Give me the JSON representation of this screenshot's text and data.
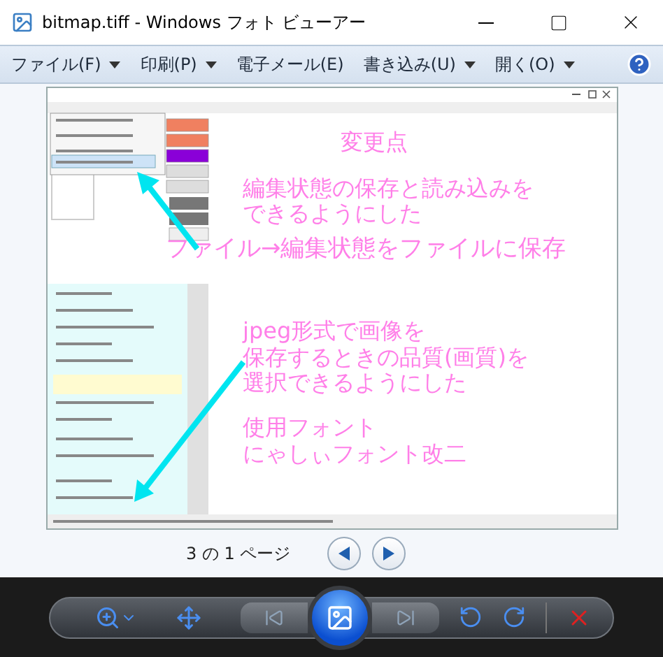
{
  "window": {
    "title": "bitmap.tiff - Windows フォト ビューアー"
  },
  "menu": [
    {
      "label": "ファイル(F)",
      "dropdown": true
    },
    {
      "label": "印刷(P)",
      "dropdown": true
    },
    {
      "label": "電子メール(E)",
      "dropdown": false
    },
    {
      "label": "書き込み(U)",
      "dropdown": true
    },
    {
      "label": "開く(O)",
      "dropdown": true
    }
  ],
  "image": {
    "notes": [
      {
        "kind": "title",
        "lines": [
          "変更点"
        ]
      },
      {
        "kind": "note",
        "lines": [
          "編集状態の保存と読み込みを",
          "できるようにした"
        ]
      },
      {
        "kind": "wide",
        "lines": [
          "ファイル→編集状態をファイルに保存"
        ]
      },
      {
        "kind": "note",
        "lines": [
          "jpeg形式で画像を",
          "保存するときの品質(画質)を",
          "選択できるようにした"
        ]
      },
      {
        "kind": "note",
        "lines": [
          "使用フォント",
          "にゃしぃフォント改二"
        ]
      }
    ]
  },
  "pager": {
    "text": "3 の 1 ページ"
  }
}
